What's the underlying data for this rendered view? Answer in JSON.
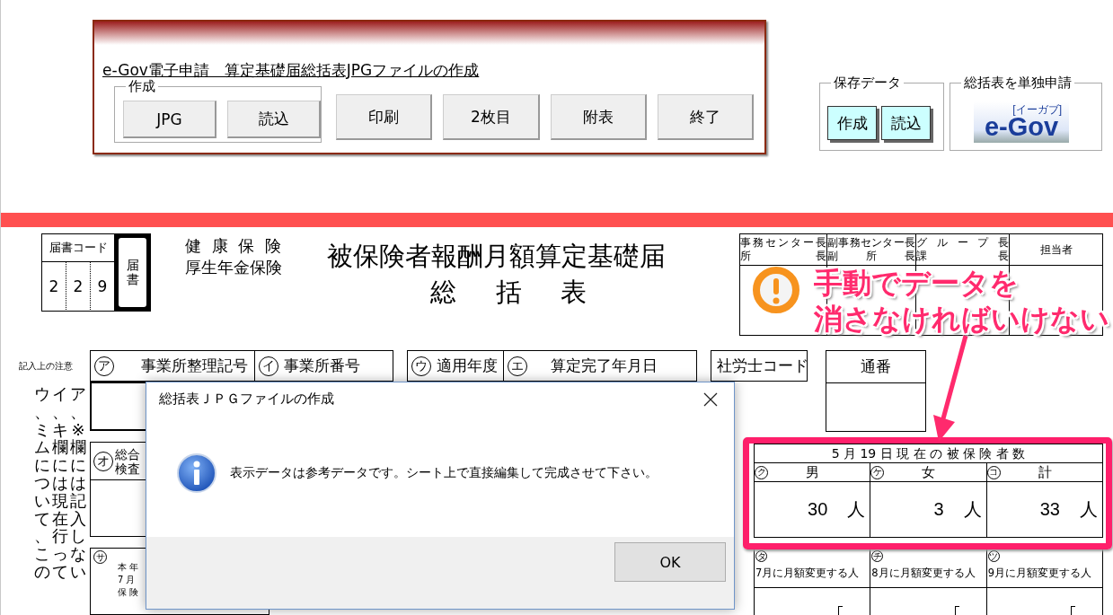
{
  "toolbar": {
    "title": "e-Gov電子申請　算定基礎届総括表JPGファイルの作成",
    "group_label": "作成",
    "group_buttons": [
      "JPG",
      "読込"
    ],
    "buttons": [
      "印刷",
      "2枚目",
      "附表",
      "終了"
    ]
  },
  "saved_data": {
    "label": "保存データ",
    "buttons": [
      "作成",
      "読込"
    ]
  },
  "single_apply": {
    "label": "総括表を単独申請",
    "logo": "e-Gov",
    "logo_tag": "[イーガブ]"
  },
  "sheet": {
    "form_code": {
      "label": "届書コード",
      "digits": [
        "2",
        "2",
        "9"
      ],
      "doc_label": "届書"
    },
    "insurance": [
      "健 康 保 険",
      "厚生年金保険"
    ],
    "title": "被保険者報酬月額算定基礎届",
    "subtitle": "総括表",
    "approvals": [
      {
        "lines": [
          "事務センター長",
          "所長"
        ]
      },
      {
        "lines": [
          "副事務センター長",
          "副所長"
        ]
      },
      {
        "lines": [
          "グループ長",
          "課長"
        ]
      },
      {
        "lines": [
          "担当者"
        ]
      }
    ],
    "notes_label": "記入上の注意",
    "notes": [
      "ウ、ミムについて、この",
      "イ、キ欄には現在行って",
      "ア、※欄には記入しない"
    ],
    "header_cells": [
      {
        "mark": "ア",
        "label": "事業所整理記号"
      },
      {
        "mark": "イ",
        "label": "事業所番号"
      },
      {
        "mark": "ウ",
        "label": "適用年度"
      },
      {
        "mark": "エ",
        "label": "算定完了年月日"
      }
    ],
    "sharoushi": "社労士コード",
    "serial": "通番",
    "inspection": {
      "mark": "オ",
      "lines": [
        "総合",
        "検査"
      ]
    },
    "section_sa": {
      "mark": "サ",
      "lines": [
        "本年",
        "7月",
        "保険"
      ]
    },
    "counts": {
      "title": "5 月 19 日 現 在 の 被 保 険 者 数",
      "columns": [
        {
          "mark": "ク",
          "label": "男",
          "value": "30",
          "unit": "人"
        },
        {
          "mark": "ケ",
          "label": "女",
          "value": "3",
          "unit": "人"
        },
        {
          "mark": "コ",
          "label": "計",
          "value": "33",
          "unit": "人"
        }
      ]
    },
    "changes": [
      {
        "mark": "タ",
        "label": "7月に月額変更する人"
      },
      {
        "mark": "チ",
        "label": "8月に月額変更する人"
      },
      {
        "mark": "ツ",
        "label": "9月に月額変更する人"
      }
    ]
  },
  "callout": {
    "lines": [
      "手動でデータを",
      "消さなければいけない"
    ]
  },
  "dialog": {
    "title": "総括表ＪＰＧファイルの作成",
    "message": "表示データは参考データです。シート上で直接編集して完成させて下さい。",
    "button": "OK"
  }
}
